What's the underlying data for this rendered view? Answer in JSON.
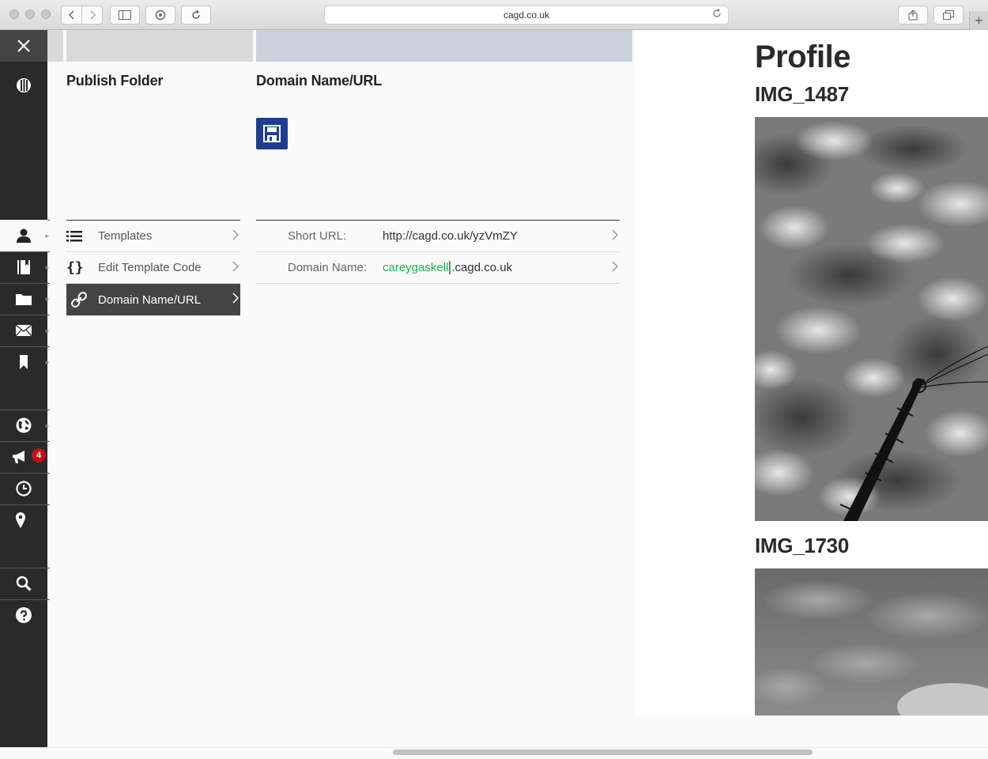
{
  "browser": {
    "address": "cagd.co.uk",
    "icons": [
      "back-icon",
      "forward-icon",
      "sidebar-toggle-icon",
      "privacy-icon",
      "refresh-icon",
      "share-icon",
      "tabs-icon",
      "new-tab-icon"
    ]
  },
  "sidebar": {
    "badge_count": "4",
    "items": [
      "close-icon",
      "logo-icon",
      "user-icon",
      "book-icon",
      "folder-icon",
      "mail-icon",
      "bookmark-icon",
      "globe-icon",
      "megaphone-icon",
      "clock-icon",
      "location-pin-icon",
      "search-icon",
      "help-icon"
    ]
  },
  "columns": {
    "left_title": "Publish Folder",
    "right_title": "Domain Name/URL",
    "left_bar_color": "#d9d9d9",
    "right_bar_color": "#cbd2dd"
  },
  "menu": [
    {
      "label": "Templates",
      "icon": "list-icon"
    },
    {
      "label": "Edit Template Code",
      "icon": "braces-icon"
    },
    {
      "label": "Domain Name/URL",
      "icon": "link-icon",
      "active": true
    }
  ],
  "properties": {
    "short_url_label": "Short URL:",
    "short_url_value": "http://cagd.co.uk/yzVmZY",
    "domain_label": "Domain Name:",
    "domain_subdomain": "careygaskell",
    "domain_suffix": ".cagd.co.uk"
  },
  "preview": {
    "title": "Profile",
    "images": [
      {
        "caption": "IMG_1487"
      },
      {
        "caption": "IMG_1730"
      }
    ]
  },
  "colors": {
    "sidebar_bg": "#2a2a2a",
    "save_button": "#1f3d8f",
    "badge": "#c0121d",
    "subdomain_text": "#22b14c"
  }
}
